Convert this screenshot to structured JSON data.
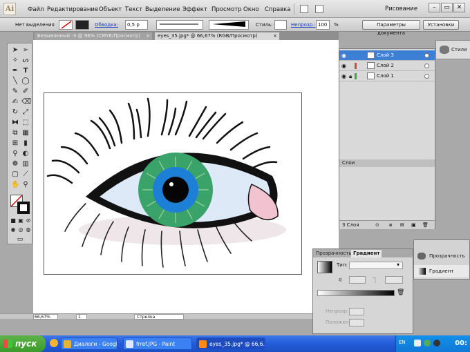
{
  "app": {
    "logo": "Ai",
    "workspace": "Рисование"
  },
  "menu": [
    "Файл",
    "Редактирование",
    "Объект",
    "Текст",
    "Выделение",
    "Эффект",
    "Просмотр",
    "Окно",
    "Справка"
  ],
  "control_bar": {
    "selection_label": "Нет выделения",
    "stroke_label": "Обводка:",
    "stroke_value": "0,5 р",
    "style_label": "Стиль:",
    "opacity_label": "Непрозр.:",
    "opacity_value": "100",
    "percent": "%",
    "doc_settings_button": "Параметры документа",
    "preferences_button": "Установки"
  },
  "document_tabs": [
    {
      "label": "Безымянный -3 @ 96% (CMYK/Просмотр)",
      "active": false
    },
    {
      "label": "eyes_35.jpg* @ 66,67% (RGB/Просмотр)",
      "active": true
    }
  ],
  "layers": {
    "title": "Слои",
    "items": [
      {
        "name": "Слой 3",
        "selected": true,
        "color": "#3c7fdb"
      },
      {
        "name": "Слой 2",
        "selected": false,
        "color": "#e04040"
      },
      {
        "name": "Слой 1",
        "selected": false,
        "color": "#3fa83f"
      }
    ],
    "footer_count": "3 Слоя"
  },
  "dock": {
    "label": "Стили"
  },
  "gradient_panel": {
    "tabs": [
      {
        "label": "Прозрачность",
        "active": false
      },
      {
        "label": "Градиент",
        "active": true
      }
    ],
    "type_label": "Тип:",
    "opacity_label": "Непрозр.",
    "location_label": "Положение"
  },
  "mini_panel": {
    "items": [
      "Прозрачность",
      "Градиент"
    ]
  },
  "status": {
    "zoom": "66,67%",
    "page": "1",
    "tool": "Стрелка"
  },
  "taskbar": {
    "start": "пуск",
    "buttons": [
      {
        "label": "Диалоги - Google Ch...",
        "icon_color": "#e8b13a"
      },
      {
        "label": "frref.JPG - Paint",
        "icon_color": "#dfe8ff"
      },
      {
        "label": "eyes_35.jpg* @ 66,6...",
        "icon_color": "#ff8a1a"
      }
    ],
    "language": "EN",
    "clock": "00:"
  }
}
